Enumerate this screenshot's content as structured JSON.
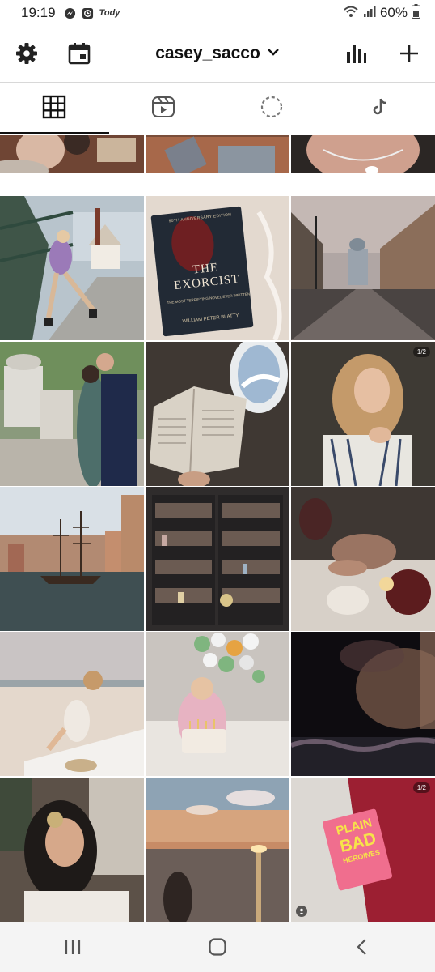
{
  "status_bar": {
    "time": "19:19",
    "notification_icons": [
      "messenger-icon",
      "clock-app-icon"
    ],
    "tody_label": "Tody",
    "battery": "60%"
  },
  "header": {
    "username": "casey_sacco"
  },
  "tabs": [
    {
      "icon": "grid-icon",
      "active": true
    },
    {
      "icon": "reels-icon",
      "active": false
    },
    {
      "icon": "loading-circle-icon",
      "active": false
    },
    {
      "icon": "tiktok-icon",
      "active": false
    }
  ],
  "book": {
    "edition": "50TH ANNIVERSARY EDITION",
    "title": "THE EXORCIST",
    "tagline": "THE MOST TERRIFYING NOVEL EVER WRITTEN",
    "author": "WILLIAM PETER BLATTY"
  },
  "post_badges": {
    "portrait": "1/2",
    "pin": "1/2"
  },
  "pin_book": {
    "line1": "PLAIN",
    "line2": "BAD",
    "line3": "HEROINES"
  },
  "accent_colors": {
    "header_border": "#d8d8d8",
    "active_tab": "#111111"
  }
}
